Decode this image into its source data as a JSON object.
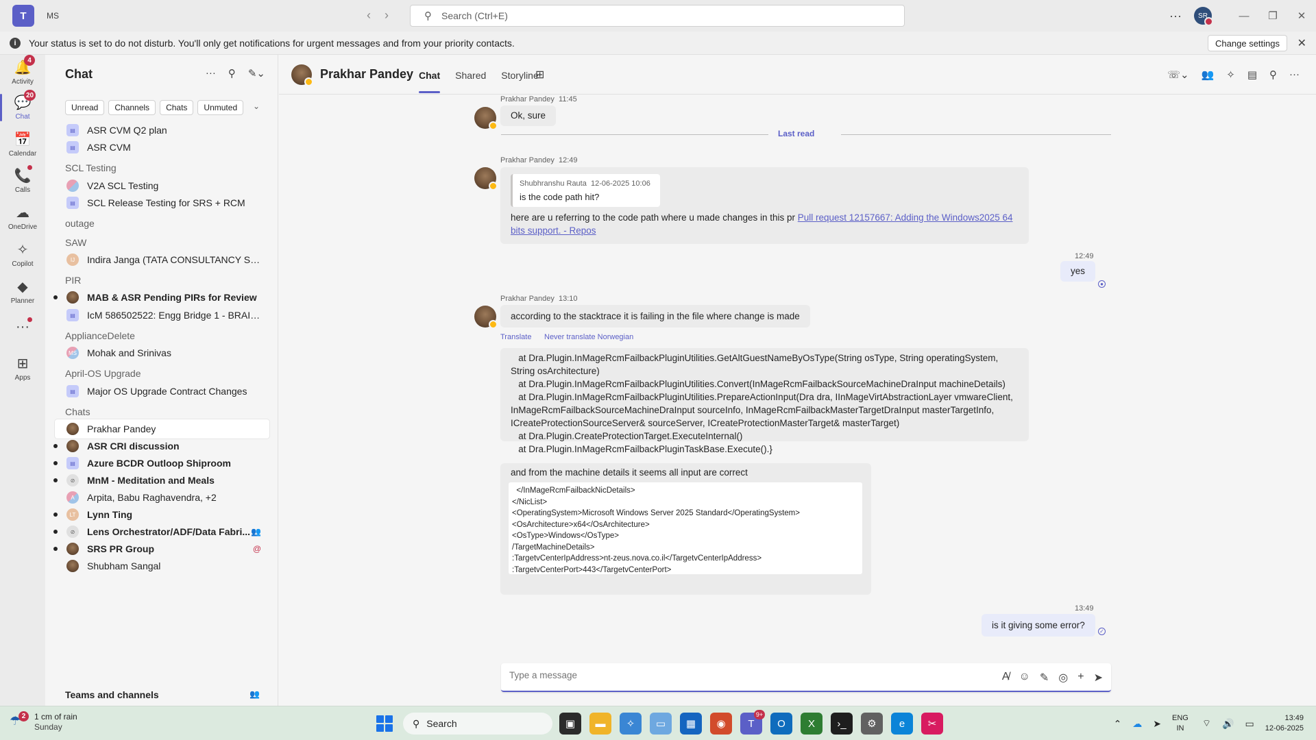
{
  "titlebar": {
    "app_short": "MS",
    "logo": "T",
    "search_placeholder": "Search (Ctrl+E)",
    "user_initials": "SR",
    "more": "···",
    "back": "‹",
    "forward": "›",
    "minimize": "—",
    "restore": "❐",
    "close": "✕"
  },
  "banner": {
    "text": "Your status is set to do not disturb. You'll only get notifications for urgent messages and from your priority contacts.",
    "button": "Change settings",
    "close": "✕"
  },
  "rail": [
    {
      "label": "Activity",
      "glyph": "🔔",
      "badge": "4"
    },
    {
      "label": "Chat",
      "glyph": "💬",
      "badge": "20",
      "active": true
    },
    {
      "label": "Calendar",
      "glyph": "📅",
      "badge": ""
    },
    {
      "label": "Calls",
      "glyph": "📞",
      "badge": "",
      "dot": true
    },
    {
      "label": "OneDrive",
      "glyph": "☁",
      "badge": ""
    },
    {
      "label": "Copilot",
      "glyph": "✧",
      "badge": ""
    },
    {
      "label": "Planner",
      "glyph": "◆",
      "badge": ""
    },
    {
      "label": "",
      "glyph": "···",
      "badge": "",
      "dot": true
    },
    {
      "label": "Apps",
      "glyph": "⊞",
      "badge": ""
    }
  ],
  "sidebar": {
    "title": "Chat",
    "filters": [
      "Unread",
      "Channels",
      "Chats",
      "Unmuted"
    ],
    "items": [
      {
        "type": "row",
        "label": "ASR CVM Q2 plan",
        "avatar": "grp"
      },
      {
        "type": "row",
        "label": "ASR CVM",
        "avatar": "grp"
      },
      {
        "type": "section",
        "label": "SCL Testing"
      },
      {
        "type": "row",
        "label": "V2A SCL Testing",
        "avatar": "multi"
      },
      {
        "type": "row",
        "label": "SCL Release Testing for SRS + RCM",
        "avatar": "grp"
      },
      {
        "type": "section",
        "label": "outage"
      },
      {
        "type": "section",
        "label": "SAW"
      },
      {
        "type": "row",
        "label": "Indira Janga (TATA CONSULTANCY SERVICE...",
        "avatar": "u",
        "initials": "IJ"
      },
      {
        "type": "section",
        "label": "PIR"
      },
      {
        "type": "row",
        "label": "MAB & ASR Pending PIRs for Review",
        "avatar": "photo",
        "bold": true,
        "dot": true
      },
      {
        "type": "row",
        "label": "IcM 586502522: Engg Bridge 1 - BRAIN det...",
        "avatar": "grp"
      },
      {
        "type": "section",
        "label": "ApplianceDelete"
      },
      {
        "type": "row",
        "label": "Mohak and Srinivas",
        "avatar": "multi",
        "initials": "MS"
      },
      {
        "type": "section",
        "label": "April-OS Upgrade"
      },
      {
        "type": "row",
        "label": "Major OS Upgrade Contract Changes",
        "avatar": "grp"
      },
      {
        "type": "section",
        "label": "Chats"
      },
      {
        "type": "row",
        "label": "Prakhar Pandey",
        "avatar": "photo",
        "selected": true
      },
      {
        "type": "row",
        "label": "ASR CRI discussion",
        "avatar": "photo",
        "bold": true,
        "dot": true
      },
      {
        "type": "row",
        "label": "Azure BCDR Outloop Shiproom",
        "avatar": "grp",
        "bold": true,
        "dot": true
      },
      {
        "type": "row",
        "label": "MnM - Meditation and Meals",
        "avatar": "muted",
        "bold": true,
        "dot": true
      },
      {
        "type": "row",
        "label": "Arpita, Babu Raghavendra, +2",
        "avatar": "multi",
        "initials": "A"
      },
      {
        "type": "row",
        "label": "Lynn Ting",
        "avatar": "u",
        "initials": "LT",
        "bold": true,
        "dot": true
      },
      {
        "type": "row",
        "label": "Lens Orchestrator/ADF/Data Fabri...",
        "avatar": "muted",
        "bold": true,
        "dot": true,
        "ricon": "people"
      },
      {
        "type": "row",
        "label": "SRS PR Group",
        "avatar": "photo",
        "bold": true,
        "dot": true,
        "ricon": "@"
      },
      {
        "type": "row",
        "label": "Shubham Sangal",
        "avatar": "photo"
      }
    ],
    "footer": "Teams and channels"
  },
  "chat": {
    "name": "Prakhar Pandey",
    "tabs": [
      "Chat",
      "Shared",
      "Storyline"
    ],
    "last_read": "Last read",
    "messages": {
      "m1": {
        "sender": "Prakhar Pandey",
        "time": "11:45",
        "text": "Ok, sure"
      },
      "m2": {
        "sender": "Prakhar Pandey",
        "time": "12:49",
        "quote_author": "Shubhranshu Rauta",
        "quote_time": "12-06-2025 10:06",
        "quote_text": "is the code path hit?",
        "text": "here are u referring to the code path where u made changes in this pr ",
        "link": "Pull request 12157667: Adding the Windows2025 64 bits support. - Repos"
      },
      "m3": {
        "time": "12:49",
        "text": "yes"
      },
      "m4": {
        "sender": "Prakhar Pandey",
        "time": "13:10",
        "text": "according to the stacktrace it is failing in the file where change is made",
        "translate": "Translate",
        "never_translate": "Never translate Norwegian"
      },
      "m5": {
        "lines": [
          "   at Dra.Plugin.InMageRcmFailbackPluginUtilities.GetAltGuestNameByOsType(String osType, String operatingSystem, String osArchitecture)",
          "   at Dra.Plugin.InMageRcmFailbackPluginUtilities.Convert(InMageRcmFailbackSourceMachineDraInput machineDetails)",
          "   at Dra.Plugin.InMageRcmFailbackPluginUtilities.PrepareActionInput(Dra dra, IInMageVirtAbstractionLayer vmwareClient, InMageRcmFailbackSourceMachineDraInput sourceInfo, InMageRcmFailbackMasterTargetDraInput masterTargetInfo, ICreateProtectionSourceServer& sourceServer, ICreateProtectionMasterTarget& masterTarget)",
          "   at Dra.Plugin.CreateProtectionTarget.ExecuteInternal()",
          "   at Dra.Plugin.InMageRcmFailbackPluginTaskBase.Execute().}"
        ]
      },
      "m6": {
        "text": "and from the machine details it seems all input are correct",
        "code": "  </InMageRcmFailbackNicDetails>\n</NicList>\n<OperatingSystem>Microsoft Windows Server 2025 Standard</OperatingSystem>\n<OsArchitecture>x64</OsArchitecture>\n<OsType>Windows</OsType>\n/TargetMachineDetails>\n:TargetvCenterIpAddress>nt-zeus.nova.co.il</TargetvCenterIpAddress>\n:TargetvCenterPort>443</TargetvCenterPort>"
      },
      "m7": {
        "time": "13:49",
        "text": "is it giving some error?"
      }
    },
    "compose_placeholder": "Type a message"
  },
  "taskbar": {
    "weather_badge": "2",
    "weather_temp": "1 cm of rain",
    "weather_day": "Sunday",
    "search": "Search",
    "lang1": "ENG",
    "lang2": "IN",
    "time": "13:49",
    "date": "12-06-2025",
    "teams_badge": "9+"
  },
  "colors": {
    "accent": "#5b5fc7",
    "alert": "#c4314b",
    "away": "#fdb913"
  }
}
